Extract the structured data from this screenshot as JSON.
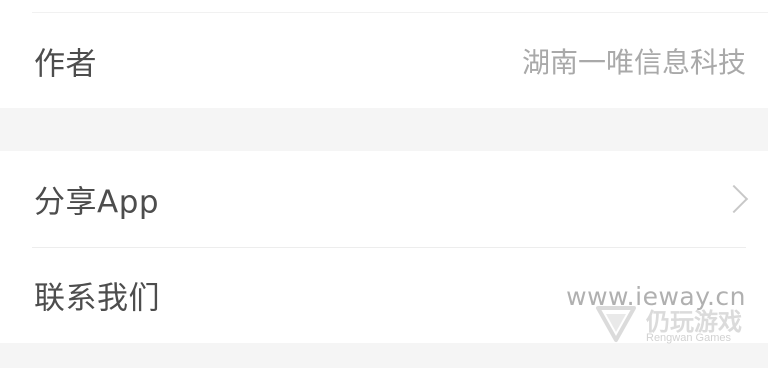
{
  "settings": {
    "author": {
      "label": "作者",
      "value": "湖南一唯信息科技"
    },
    "share": {
      "label": "分享App",
      "icon": "chevron-right-icon"
    },
    "contact": {
      "label": "联系我们"
    }
  },
  "watermark": {
    "url": "www.ieway.cn",
    "brand_cn": "仍玩游戏",
    "brand_en": "Rengwan Games"
  },
  "colors": {
    "background": "#f5f5f5",
    "card": "#ffffff",
    "label_text": "#4d4d4d",
    "value_text": "#a9a9a9"
  }
}
